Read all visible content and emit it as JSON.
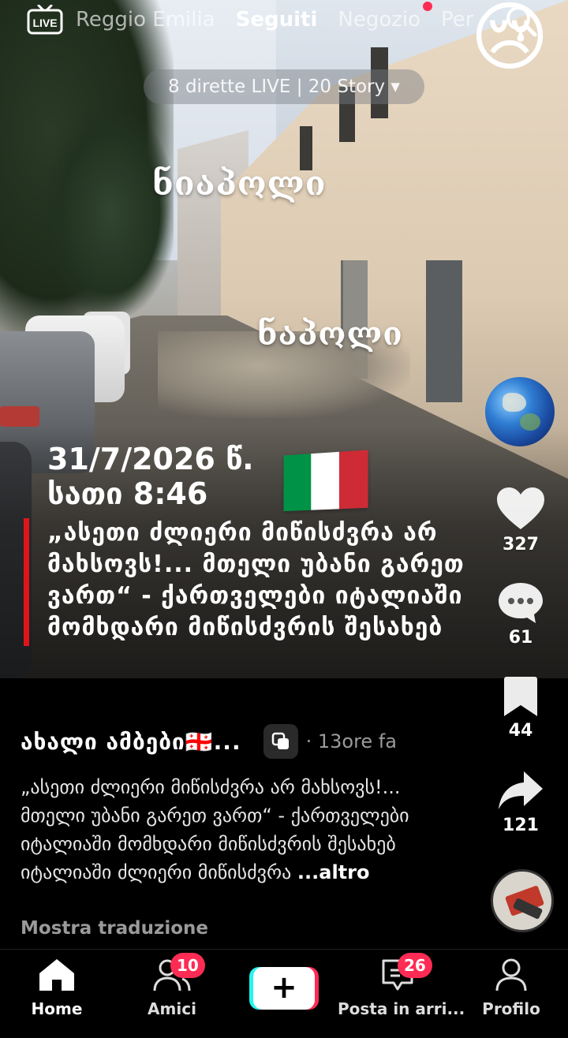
{
  "top_bar": {
    "live_label": "LIVE",
    "tabs": [
      {
        "label": "Reggio Emilia"
      },
      {
        "label": "Seguiti"
      },
      {
        "label": "Negozio"
      },
      {
        "label": "Per"
      }
    ],
    "active_tab": "Seguiti",
    "live_pill": "8 dirette LIVE | 20 Story ▾",
    "notification_dot_color": "#fe2c55",
    "emoji": "😢"
  },
  "video_overlay": {
    "city_top": "ნიაპოლი",
    "city_mid": "ნაპოლი",
    "date": "31/7/2026 წ.",
    "time": "სათი 8:46",
    "headline": "„ასეთი ძლიერი მიწისძვრა არ მახსოვს!... მთელი უბანი გარეთ ვართ“ - ქართველები იტალიაში მომხდარი მიწისძვრის შესახებ",
    "flag_colors": [
      "#009246",
      "#ffffff",
      "#ce2b37"
    ],
    "accent_bar_color": "#e0151b"
  },
  "actions": {
    "likes": "327",
    "comments": "61",
    "saves": "44",
    "shares": "121"
  },
  "post": {
    "author": "ახალი ამბები🇬🇪...",
    "posted": "· 13ore fa",
    "caption": "„ასეთი ძლიერი მიწისძვრა არ მახსოვს!... მთელი უბანი გარეთ ვართ“ - ქართველები იტალიაში მომხდარი მიწისძვრის შესახებ იტალიაში ძლიერი მიწისძვრა ",
    "more": "...altro",
    "translate": "Mostra traduzione"
  },
  "bottom_nav": {
    "home": "Home",
    "friends": "Amici",
    "friends_badge": "10",
    "create": "+",
    "inbox": "Posta in arri...",
    "inbox_badge": "26",
    "profile": "Profilo"
  }
}
